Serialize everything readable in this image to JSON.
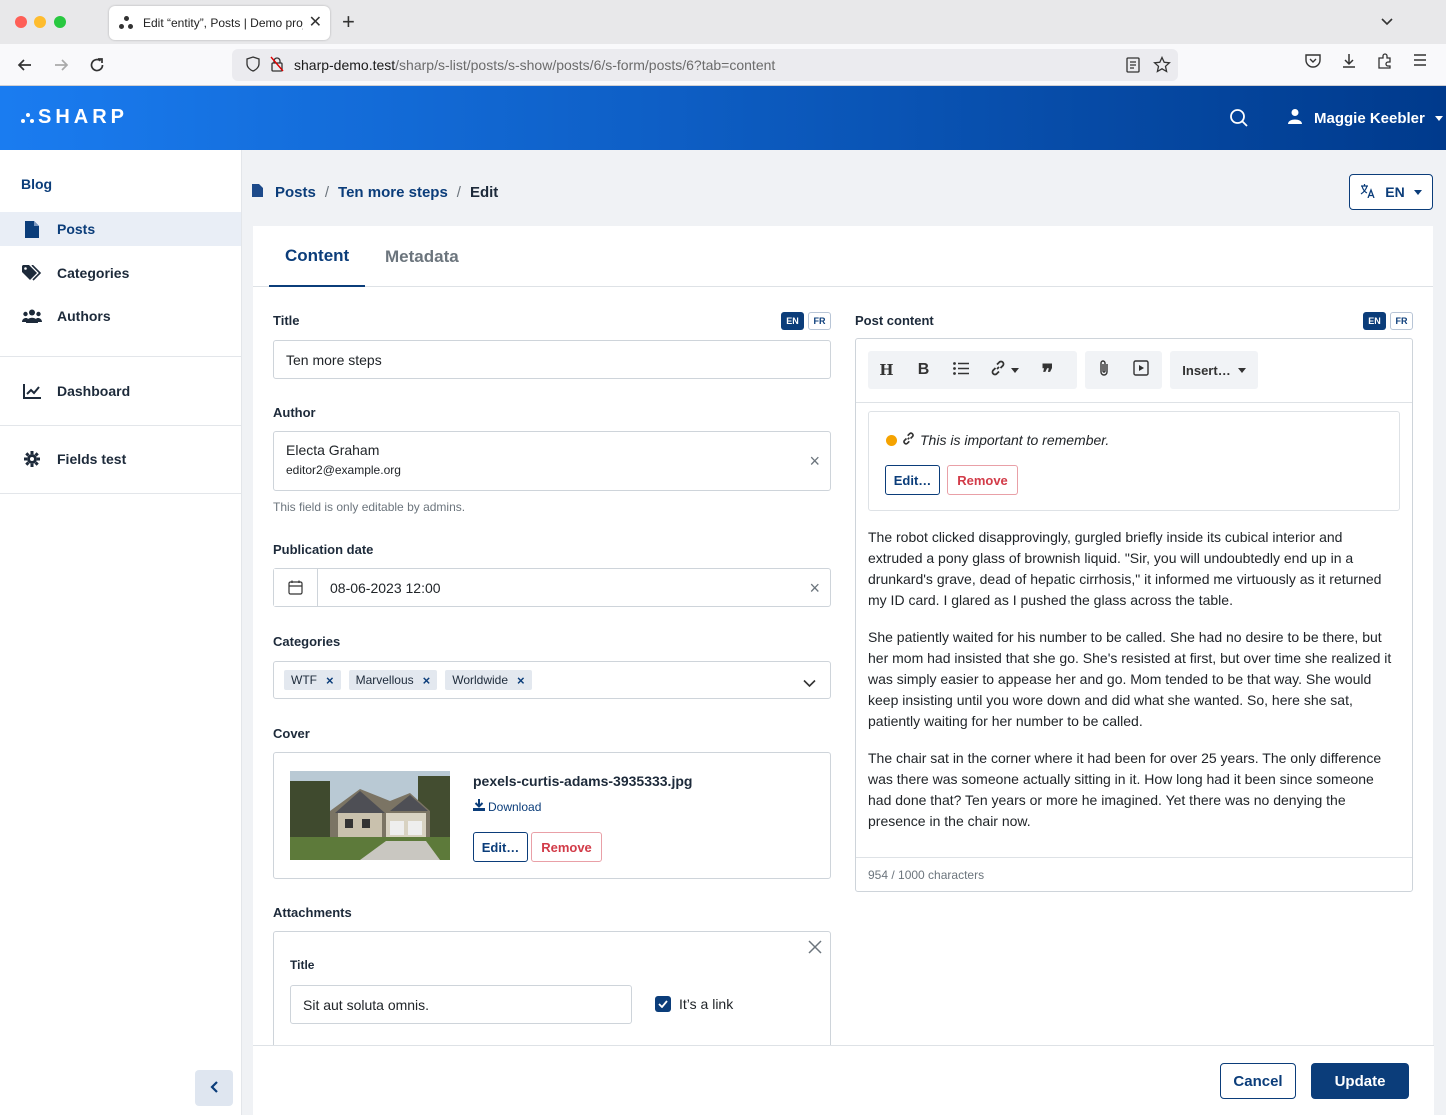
{
  "browser": {
    "tab_title": "Edit “entity”, Posts | Demo project",
    "url_host": "sharp-demo.test",
    "url_path": "/sharp/s-list/posts/s-show/posts/6/s-form/posts/6?tab=content"
  },
  "header": {
    "logo": "SHARP",
    "user_name": "Maggie Keebler"
  },
  "sidebar": {
    "heading": "Blog",
    "items": [
      {
        "label": "Posts",
        "icon": "file-icon",
        "active": true
      },
      {
        "label": "Categories",
        "icon": "tags-icon"
      },
      {
        "label": "Authors",
        "icon": "users-icon"
      },
      {
        "label": "Dashboard",
        "icon": "chart-line-icon"
      },
      {
        "label": "Fields test",
        "icon": "gear-icon"
      }
    ]
  },
  "breadcrumb": {
    "items": [
      "Posts",
      "Ten more steps",
      "Edit"
    ]
  },
  "locale_switch": "EN",
  "tabs": [
    "Content",
    "Metadata"
  ],
  "locales": [
    "EN",
    "FR"
  ],
  "form": {
    "title_label": "Title",
    "title_value": "Ten more steps",
    "author_label": "Author",
    "author_name": "Electa Graham",
    "author_email": "editor2@example.org",
    "author_help": "This field is only editable by admins.",
    "pubdate_label": "Publication date",
    "pubdate_value": "08-06-2023 12:00",
    "categories_label": "Categories",
    "categories": [
      "WTF",
      "Marvellous",
      "Worldwide"
    ],
    "cover_label": "Cover",
    "cover_filename": "pexels-curtis-adams-3935333.jpg",
    "cover_download": "Download",
    "edit_label": "Edit…",
    "remove_label": "Remove",
    "attachments_label": "Attachments",
    "attachment_title_label": "Title",
    "attachment_title_value": "Sit aut soluta omnis.",
    "attachment_link_label": "It’s a link",
    "attachment_link_checked": true
  },
  "post_content": {
    "label": "Post content",
    "insert_label": "Insert…",
    "embed_text": "This is important to remember.",
    "paragraphs": [
      "The robot clicked disapprovingly, gurgled briefly inside its cubical interior and extruded a pony glass of brownish liquid. \"Sir, you will undoubtedly end up in a drunkard's grave, dead of hepatic cirrhosis,\" it informed me virtuously as it returned my ID card. I glared as I pushed the glass across the table.",
      "She patiently waited for his number to be called. She had no desire to be there, but her mom had insisted that she go. She's resisted at first, but over time she realized it was simply easier to appease her and go. Mom tended to be that way. She would keep insisting until you wore down and did what she wanted. So, here she sat, patiently waiting for her number to be called.",
      "The chair sat in the corner where it had been for over 25 years. The only difference was there was someone actually sitting in it. How long had it been since someone had done that? Ten years or more he imagined. Yet there was no denying the presence in the chair now."
    ],
    "char_count": "954 / 1000 characters"
  },
  "actions": {
    "cancel": "Cancel",
    "update": "Update"
  },
  "colors": {
    "primary": "#0b3d7a",
    "header_start": "#1a7cf0",
    "header_end": "#003a8c",
    "danger": "#d23b48",
    "embed_dot": "#f5a300"
  }
}
